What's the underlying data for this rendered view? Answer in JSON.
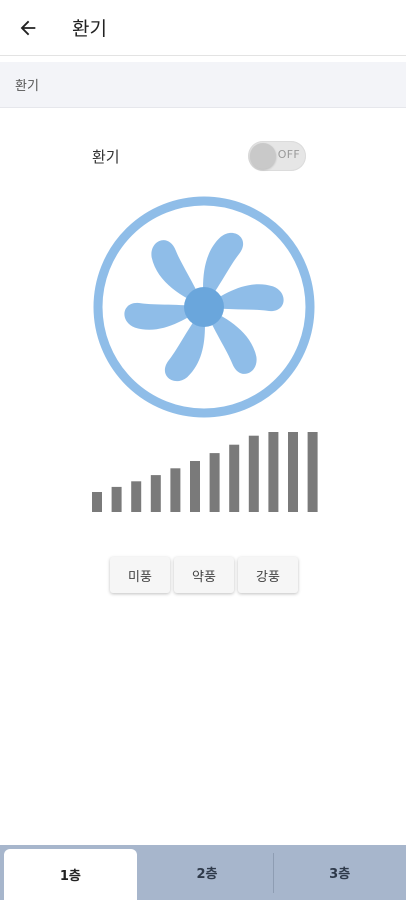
{
  "appbar": {
    "title": "환기",
    "back_icon": "arrow-left-icon"
  },
  "section": {
    "label": "환기"
  },
  "ventilation": {
    "label": "환기",
    "switch_state": "OFF",
    "fan_icon": "fan-icon",
    "fan_color": "#8fbde8",
    "fan_hub_color": "#6aa6dc",
    "bar_color": "#7a7a7a",
    "level_bars": 12
  },
  "speeds": [
    "미풍",
    "약풍",
    "강풍"
  ],
  "tabs": {
    "active_index": 0,
    "items": [
      "1층",
      "2층",
      "3층"
    ]
  }
}
